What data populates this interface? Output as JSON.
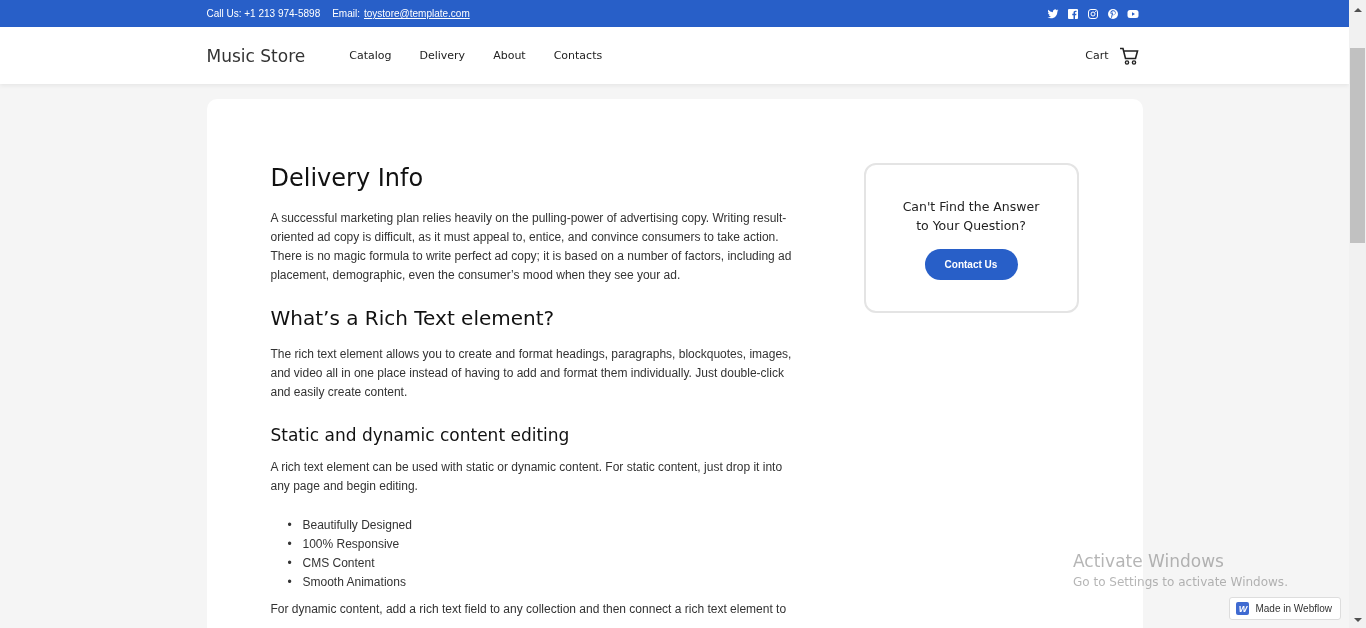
{
  "top_bar": {
    "phone": "Call Us: +1 213 974-5898",
    "email_label": "Email:",
    "email": "toystore@template.com"
  },
  "header": {
    "logo": "Music Store",
    "nav": [
      "Catalog",
      "Delivery",
      "About",
      "Contacts"
    ],
    "cart": "Cart"
  },
  "article": {
    "title": "Delivery Info",
    "blocks": [
      {
        "kind": "paragraph",
        "text": "A successful marketing plan relies heavily on the pulling-power of advertising copy. Writing result-oriented ad copy is difficult, as it must appeal to, entice, and convince consumers to take action. There is no magic formula to write perfect ad copy; it is based on a number of factors, including ad placement, demographic, even the consumer’s mood when they see your ad."
      },
      {
        "kind": "heading2",
        "text": "What’s a Rich Text element?"
      },
      {
        "kind": "paragraph",
        "text": "The rich text element allows you to create and format headings, paragraphs, blockquotes, images, and video all in one place instead of having to add and format them individually. Just double-click and easily create content."
      },
      {
        "kind": "heading3",
        "text": "Static and dynamic content editing"
      },
      {
        "kind": "paragraph",
        "text": "A rich text element can be used with static or dynamic content. For static content, just drop it into any page and begin editing."
      },
      {
        "kind": "list",
        "items": [
          {
            "marker": "•",
            "text": "Beautifully Designed"
          },
          {
            "marker": "•",
            "text": "100% Responsive"
          },
          {
            "marker": "•",
            "text": "CMS Content"
          },
          {
            "marker": "•",
            "text": "Smooth Animations"
          }
        ]
      },
      {
        "kind": "cut_paragraph",
        "text": "For dynamic content, add a rich text field to any collection and then connect a rich text element to"
      }
    ]
  },
  "help_card": {
    "title_lines": [
      "Can't Find the Answer",
      "to Your Question?"
    ],
    "button": "Contact Us"
  },
  "webflow_badge": {
    "logo": "W",
    "label": "Made in Webflow"
  },
  "windows_notice": {
    "title": "Activate Windows",
    "subtitle": "Go to Settings to activate Windows."
  }
}
